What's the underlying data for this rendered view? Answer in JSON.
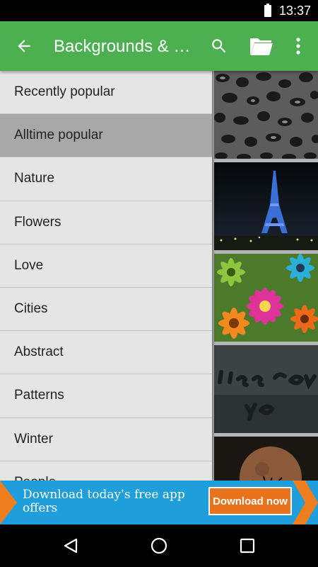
{
  "status_bar": {
    "time": "13:37",
    "battery_icon": "battery-full-icon"
  },
  "app_bar": {
    "title": "Backgrounds & Wallpapers",
    "color": "#4caf50",
    "icons": [
      "back-arrow-icon",
      "search-icon",
      "folder-icon",
      "more-vert-icon"
    ]
  },
  "drawer": {
    "items": [
      {
        "label": "Recently popular",
        "selected": false
      },
      {
        "label": "Alltime popular",
        "selected": true
      },
      {
        "label": "Nature",
        "selected": false
      },
      {
        "label": "Flowers",
        "selected": false
      },
      {
        "label": "Love",
        "selected": false
      },
      {
        "label": "Cities",
        "selected": false
      },
      {
        "label": "Abstract",
        "selected": false
      },
      {
        "label": "Patterns",
        "selected": false
      },
      {
        "label": "Winter",
        "selected": false
      },
      {
        "label": "People",
        "selected": false
      }
    ]
  },
  "thumbnails": [
    {
      "subject": "leopard-print-pattern"
    },
    {
      "subject": "eiffel-tower-night"
    },
    {
      "subject": "gerbera-flowers"
    },
    {
      "subject": "miss-you-text"
    },
    {
      "subject": "moon-tree-silhouette"
    }
  ],
  "ad": {
    "text": "Download today's free app offers",
    "button_label": "Download now",
    "bg_color": "#1e9fdc",
    "accent_color": "#f07d1e"
  },
  "nav_bar": {
    "icons": [
      "back-triangle-icon",
      "home-circle-icon",
      "recents-square-icon"
    ]
  }
}
